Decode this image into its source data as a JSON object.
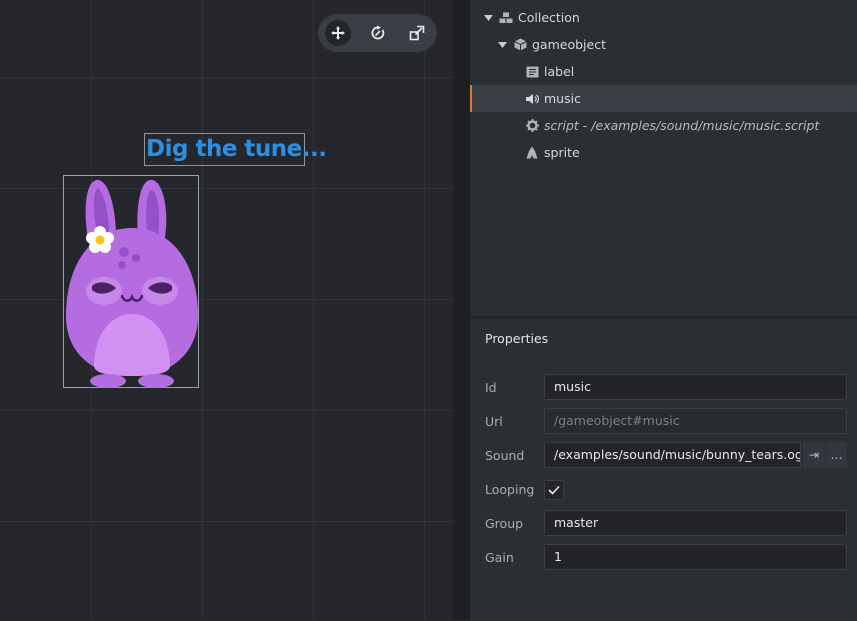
{
  "scene": {
    "label_text": "Dig the tune...",
    "toolbar": [
      "move-tool-icon",
      "rotate-tool-icon",
      "scale-tool-icon"
    ]
  },
  "outline": {
    "items": [
      {
        "label": "Collection",
        "icon": "collection-icon",
        "expanded": true
      },
      {
        "label": "gameobject",
        "icon": "gameobject-icon",
        "expanded": true
      },
      {
        "label": "label",
        "icon": "label-icon"
      },
      {
        "label": "music",
        "icon": "sound-icon",
        "selected": true
      },
      {
        "label": "script - /examples/sound/music/music.script",
        "icon": "script-gear-icon"
      },
      {
        "label": "sprite",
        "icon": "sprite-icon"
      }
    ]
  },
  "properties": {
    "title": "Properties",
    "id_label": "Id",
    "id_value": "music",
    "url_label": "Url",
    "url_value": "/gameobject#music",
    "sound_label": "Sound",
    "sound_value": "/examples/sound/music/bunny_tears.ogg",
    "sound_goto": "⇥",
    "sound_browse": "…",
    "looping_label": "Looping",
    "looping_value": true,
    "group_label": "Group",
    "group_value": "master",
    "gain_label": "Gain",
    "gain_value": "1"
  },
  "colors": {
    "accent": "#e8742f",
    "label_text": "#2d8fe2",
    "bunny": "#b56ce0"
  }
}
